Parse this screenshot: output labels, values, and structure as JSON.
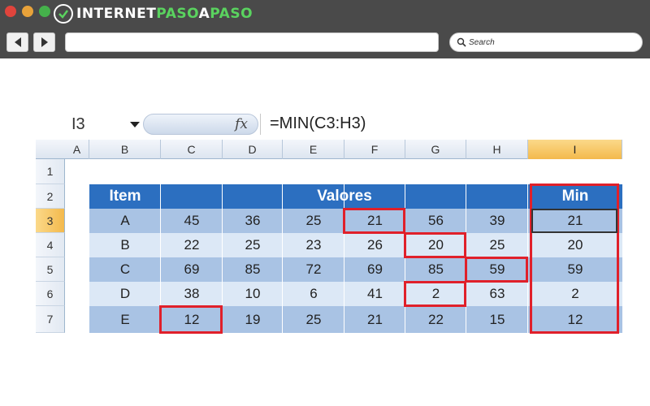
{
  "site": {
    "brand_part1": "INTERNET",
    "brand_part2": "PASO",
    "brand_part3": "A",
    "brand_part4": "PASO",
    "search_placeholder": "Search",
    "accent_color": "#5ad35f"
  },
  "spreadsheet": {
    "name_box": "I3",
    "fx_label": "fx",
    "formula": "=MIN(C3:H3)",
    "columns": [
      "A",
      "B",
      "C",
      "D",
      "E",
      "F",
      "G",
      "H",
      "I"
    ],
    "rows": [
      "1",
      "2",
      "3",
      "4",
      "5",
      "6",
      "7"
    ],
    "selected_column": "I",
    "selected_row": "3",
    "table": {
      "item_header": "Item",
      "values_header": "Valores",
      "min_header": "Min",
      "header_color": "#2c6fc0",
      "highlight_color": "#e0202a",
      "data": [
        {
          "item": "A",
          "values": [
            "45",
            "36",
            "25",
            "21",
            "56",
            "39"
          ],
          "min": "21"
        },
        {
          "item": "B",
          "values": [
            "22",
            "25",
            "23",
            "26",
            "20",
            "25"
          ],
          "min": "20"
        },
        {
          "item": "C",
          "values": [
            "69",
            "85",
            "72",
            "69",
            "85",
            "59"
          ],
          "min": "59"
        },
        {
          "item": "D",
          "values": [
            "38",
            "10",
            "6",
            "41",
            "2",
            "63"
          ],
          "min": "2"
        },
        {
          "item": "E",
          "values": [
            "12",
            "19",
            "25",
            "21",
            "22",
            "15"
          ],
          "min": "12"
        }
      ]
    }
  }
}
